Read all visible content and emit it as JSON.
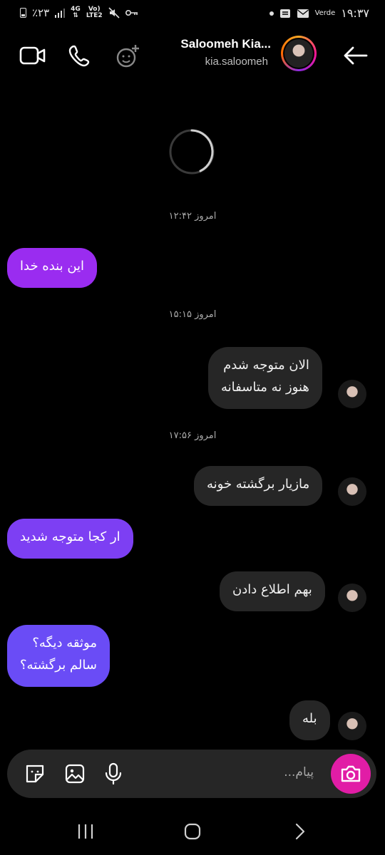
{
  "status_bar": {
    "battery": "٪۲۳",
    "network_top": "4G",
    "network_bottom": "LTE2",
    "volte": "Vo)",
    "carrier": "Verde",
    "time": "۱۹:۳۷"
  },
  "header": {
    "name": "Saloomeh Kia...",
    "username": "kia.saloomeh"
  },
  "messages": [
    {
      "type": "timestamp",
      "text": "امروز ۱۲:۴۲"
    },
    {
      "type": "outgoing",
      "lines": [
        "این بنده خدا"
      ],
      "color": "#9a2cf0"
    },
    {
      "type": "timestamp",
      "text": "امروز ۱۵:۱۵"
    },
    {
      "type": "incoming",
      "lines": [
        "الان متوجه شدم",
        "هنوز نه متاسفانه"
      ]
    },
    {
      "type": "timestamp",
      "text": "امروز ۱۷:۵۶"
    },
    {
      "type": "incoming",
      "lines": [
        "مازیار برگشته خونه"
      ]
    },
    {
      "type": "outgoing",
      "lines": [
        "ار کجا متوجه شدید"
      ],
      "color": "#7d3ff3"
    },
    {
      "type": "incoming",
      "lines": [
        "بهم اطلاع دادن"
      ]
    },
    {
      "type": "outgoing",
      "lines": [
        "موثقه دیگه؟",
        "سالم برگشته؟"
      ],
      "color": "#6a4cf6"
    },
    {
      "type": "incoming",
      "lines": [
        "بله"
      ]
    }
  ],
  "composer": {
    "placeholder": "پیام..."
  },
  "colors": {
    "background": "#000000",
    "incoming_bubble": "#262626",
    "camera_button": "#e11da6"
  },
  "icons": {
    "header": [
      "video-call-icon",
      "phone-icon",
      "add-people-icon",
      "back-arrow-icon"
    ],
    "composer": [
      "sticker-icon",
      "gallery-icon",
      "microphone-icon",
      "camera-icon"
    ],
    "navbar": [
      "recent-apps-icon",
      "home-icon",
      "back-icon"
    ]
  }
}
